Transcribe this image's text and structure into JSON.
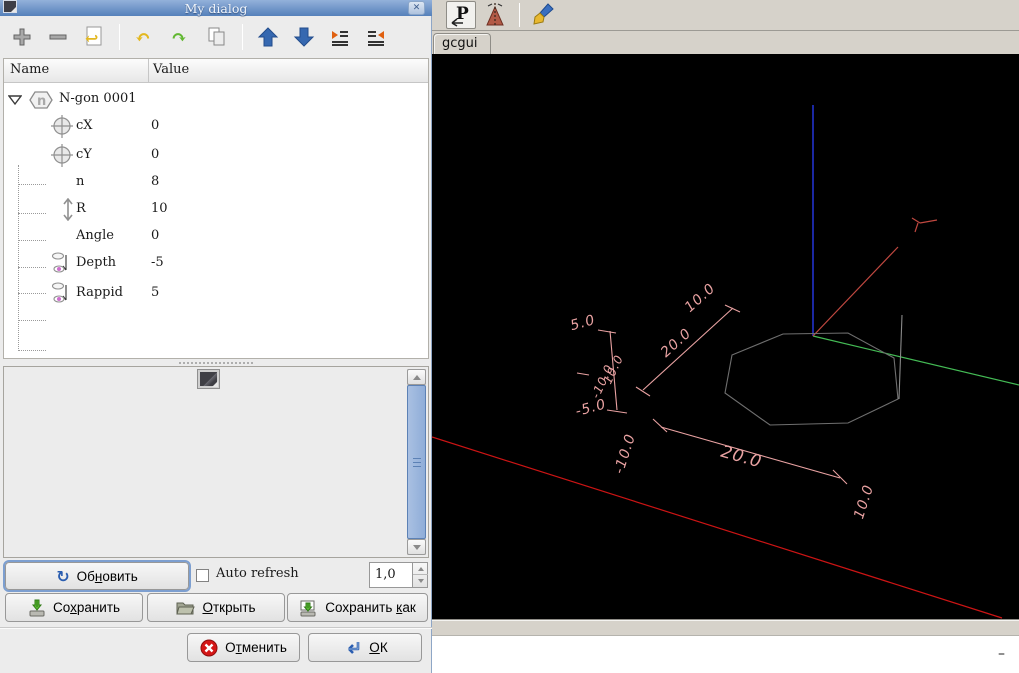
{
  "dialog": {
    "title": "My dialog",
    "toolbar_icons": [
      "plus-icon",
      "minus-icon",
      "revert-icon",
      "undo-icon",
      "redo-icon",
      "copy-icon",
      "arrow-up-icon",
      "arrow-down-icon",
      "indent-icon",
      "unindent-icon"
    ],
    "tree": {
      "columns": {
        "name": "Name",
        "value": "Value"
      },
      "root": {
        "icon": "ngon-icon",
        "label": "N-gon 0001"
      },
      "rows": [
        {
          "icon": "position-icon",
          "name": "cX",
          "value": "0"
        },
        {
          "icon": "position-icon",
          "name": "cY",
          "value": "0"
        },
        {
          "icon": "",
          "name": "n",
          "value": "8"
        },
        {
          "icon": "vertical-arrow-icon",
          "name": "R",
          "value": "10"
        },
        {
          "icon": "",
          "name": "Angle",
          "value": "0"
        },
        {
          "icon": "plunge-icon",
          "name": "Depth",
          "value": "-5"
        },
        {
          "icon": "plunge-icon",
          "name": "Rappid",
          "value": "5"
        }
      ]
    },
    "controls": {
      "refresh": {
        "label": "Обновить",
        "mnemonic": 2,
        "icon": "refresh-icon"
      },
      "auto_refresh": {
        "label": "Auto refresh",
        "checked": false
      },
      "interval": {
        "value": "1,0"
      },
      "save": {
        "label": "Сохранить",
        "mnemonic": 2,
        "icon": "save-icon"
      },
      "open": {
        "label": "Открыть",
        "mnemonic": 0,
        "icon": "open-folder-icon"
      },
      "save_as": {
        "label": "Сохранить как",
        "mnemonic": 10,
        "icon": "save-as-icon"
      },
      "cancel": {
        "label": "Отменить",
        "mnemonic": 1,
        "icon": "cancel-icon"
      },
      "ok": {
        "label": "ОК",
        "mnemonic": 0,
        "icon": "ok-arrow-icon"
      }
    }
  },
  "main": {
    "toolbar_icons": [
      "letter-p-icon",
      "cone-icon",
      "brush-icon"
    ],
    "tab_label": "gcgui",
    "bottom_dash": "–",
    "viewport": {
      "colors": {
        "dim": "#e9a2a2",
        "axis_x": "#cc1414",
        "axis_y": "#c04840",
        "axis_z": "#2233cc",
        "axis_g": "#44bb55",
        "wire": "#6f6f6f"
      },
      "labels": {
        "d1_top": "5.0",
        "d1_mid_a": "10.0",
        "d1_mid_b": "-10.0",
        "d1_bottom": "-5.0",
        "d2_len": "20.0",
        "d2_end": "10.0",
        "d3_left": "-10.0",
        "d3_len": "20.0",
        "d3_right": "10.0"
      }
    }
  }
}
